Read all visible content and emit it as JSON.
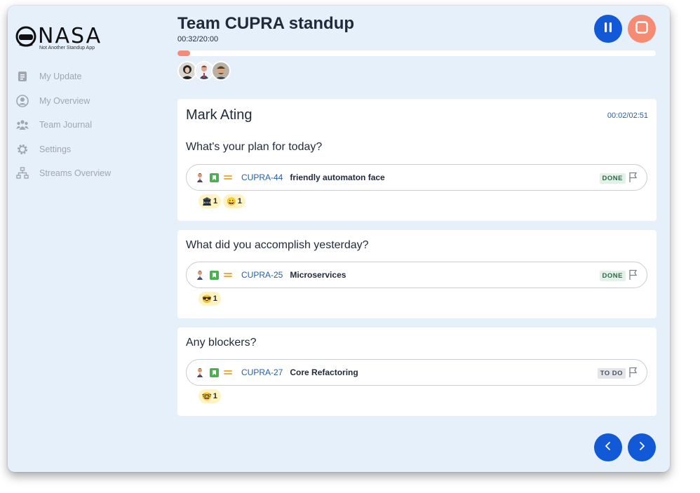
{
  "sidebar": {
    "logo_text": "NASA",
    "logo_sub": "Not Another Standup App",
    "items": [
      {
        "label": "My Update",
        "icon": "document-icon"
      },
      {
        "label": "My Overview",
        "icon": "user-circle-icon"
      },
      {
        "label": "Team Journal",
        "icon": "team-icon"
      },
      {
        "label": "Settings",
        "icon": "gear-icon"
      },
      {
        "label": "Streams Overview",
        "icon": "hierarchy-icon"
      }
    ]
  },
  "header": {
    "title": "Team CUPRA standup",
    "timer": "00:32/20:00",
    "progress": 0.027,
    "progress_color": "#f38b7a"
  },
  "card": {
    "user": "Mark Ating",
    "time": "00:02/02:51"
  },
  "sections": [
    {
      "question": "What's your plan for today?",
      "issue_key": "CUPRA-44",
      "summary": "friendly automaton face",
      "status": "DONE",
      "reactions": [
        {
          "emoji": "🏛",
          "count": "1"
        },
        {
          "emoji": "😀",
          "count": "1"
        }
      ]
    },
    {
      "question": "What did you accomplish yesterday?",
      "issue_key": "CUPRA-25",
      "summary": "Microservices",
      "status": "DONE",
      "reactions": [
        {
          "emoji": "😎",
          "count": "1"
        }
      ]
    },
    {
      "question": "Any blockers?",
      "issue_key": "CUPRA-27",
      "summary": "Core Refactoring",
      "status": "TO DO",
      "reactions": [
        {
          "emoji": "🤓",
          "count": "1"
        }
      ]
    }
  ],
  "colors": {
    "background": "#e5f0fb",
    "primary": "#1259d8",
    "stop": "#f58b73",
    "link": "#2460a8"
  }
}
